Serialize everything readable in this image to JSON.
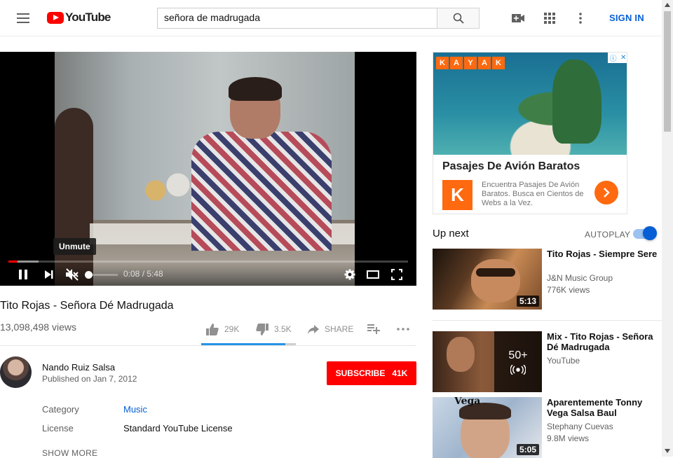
{
  "header": {
    "logo_text": "YouTube",
    "search_value": "señora de madrugada",
    "sign_in": "SIGN IN"
  },
  "player": {
    "tooltip": "Unmute",
    "time_current": "0:08",
    "time_separator": " / ",
    "time_total": "5:48",
    "progress_played": 0.023,
    "progress_loaded": 0.075
  },
  "video": {
    "title": "Tito Rojas - Señora Dé Madrugada",
    "views": "13,098,498 views",
    "likes": "29K",
    "dislikes": "3.5K",
    "share": "SHARE",
    "like_ratio": 0.89
  },
  "channel": {
    "name": "Nando Ruiz Salsa",
    "published": "Published on Jan 7, 2012",
    "subscribe_label": "SUBSCRIBE",
    "subscriber_count": "41K"
  },
  "metadata": {
    "category_label": "Category",
    "category_value": "Music",
    "license_label": "License",
    "license_value": "Standard YouTube License",
    "show_more": "SHOW MORE"
  },
  "ad": {
    "brand_letters": [
      "K",
      "A",
      "Y",
      "A",
      "K"
    ],
    "title": "Pasajes De Avión Baratos",
    "logo_letter": "K",
    "description": "Encuentra Pasajes De Avión Baratos. Busca en Cientos de Webs a la Vez."
  },
  "sidebar": {
    "up_next": "Up next",
    "autoplay": "AUTOPLAY",
    "autoplay_on": true,
    "items": [
      {
        "title": "Tito Rojas - Siempre Sere",
        "channel": "J&N Music Group",
        "views": "776K views",
        "duration": "5:13"
      },
      {
        "title": "Mix - Tito Rojas - Señora Dé Madrugada",
        "channel": "YouTube",
        "mix_count": "50+"
      },
      {
        "title": "Aparentemente Tonny Vega Salsa Baul",
        "channel": "Stephany Cuevas",
        "views": "9.8M views",
        "duration": "5:05",
        "thumb_text": "Vega"
      }
    ]
  },
  "colors": {
    "brand_red": "#ff0000",
    "link_blue": "#065fd4",
    "kayak_orange": "#ff690f"
  }
}
